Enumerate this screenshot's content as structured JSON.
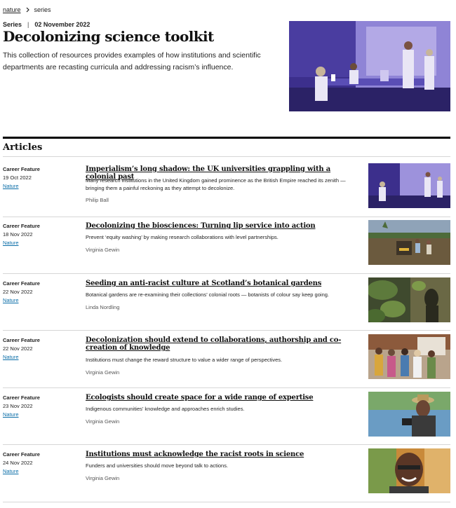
{
  "breadcrumb": {
    "home": "nature",
    "current": "series"
  },
  "hero": {
    "label": "Series",
    "date": "02 November 2022",
    "title": "Decolonizing science toolkit",
    "intro": "This collection of resources provides examples of how institutions and scientific departments are recasting curricula and addressing racism’s influence."
  },
  "section": {
    "heading": "Articles"
  },
  "articles": [
    {
      "type": "Career Feature",
      "date": "19 Oct 2022",
      "journal": "Nature",
      "title": "Imperialism’s long shadow: the UK universities grappling with a colonial past",
      "description": "Many research institutions in the United Kingdom gained prominence as the British Empire reached its zenith — bringing them a painful reckoning as they attempt to decolonize.",
      "author": "Philip Ball"
    },
    {
      "type": "Career Feature",
      "date": "18 Nov 2022",
      "journal": "Nature",
      "title": "Decolonizing the biosciences: Turning lip service into action",
      "description": "Prevent ‘equity washing’ by making research collaborations with level partnerships.",
      "author": "Virginia Gewin"
    },
    {
      "type": "Career Feature",
      "date": "22 Nov 2022",
      "journal": "Nature",
      "title": "Seeding an anti-racist culture at Scotland’s botanical gardens",
      "description": "Botanical gardens are re-examining their collections’ colonial roots — botanists of colour say keep going.",
      "author": "Linda Nordling"
    },
    {
      "type": "Career Feature",
      "date": "22 Nov 2022",
      "journal": "Nature",
      "title": "Decolonization should extend to collaborations, authorship and co-creation of knowledge",
      "description": "Institutions must change the reward structure to value a wider range of perspectives.",
      "author": "Virginia Gewin"
    },
    {
      "type": "Career Feature",
      "date": "23 Nov 2022",
      "journal": "Nature",
      "title": "Ecologists should create space for a wide range of expertise",
      "description": "Indigenous communities’ knowledge and approaches enrich studies.",
      "author": "Virginia Gewin"
    },
    {
      "type": "Career Feature",
      "date": "24 Nov 2022",
      "journal": "Nature",
      "title": "Institutions must acknowledge the racist roots in science",
      "description": "Funders and universities should move beyond talk to actions.",
      "author": "Virginia Gewin"
    }
  ],
  "colors": {
    "link": "#0b6ea8",
    "text": "#222222",
    "rule": "#000000"
  }
}
